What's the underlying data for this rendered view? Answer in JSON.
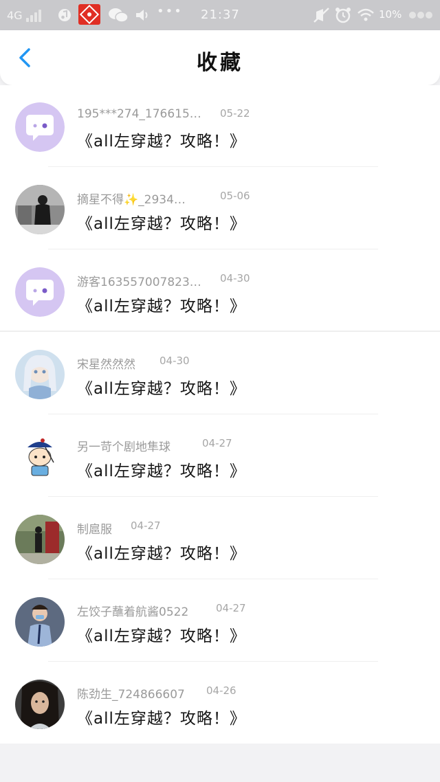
{
  "status_bar": {
    "network": "4G",
    "time": "21:37",
    "battery": "10%",
    "dots": "•••"
  },
  "header": {
    "title": "收藏",
    "back_icon": "chevron-left-icon"
  },
  "items": [
    {
      "name": "195***274_176615…",
      "date": "05-22",
      "title": "《all左穿越？攻略！》",
      "avatar": "chat-bubble-avatar",
      "avatar_color": "#d5c6f2"
    },
    {
      "name": "摘星不得✨_2934…",
      "date": "05-06",
      "title": "《all左穿越？攻略！》",
      "avatar": "photo-avatar-bw",
      "avatar_color": "#555555"
    },
    {
      "name": "游客163557007823…",
      "date": "04-30",
      "title": "《all左穿越？攻略！》",
      "avatar": "chat-bubble-avatar",
      "avatar_color": "#d5c6f2"
    },
    {
      "name": "宋星然然然",
      "date": "04-30",
      "title": "《all左穿越？攻略！》",
      "avatar": "anime-girl-avatar",
      "avatar_color": "#cfe0ee"
    },
    {
      "name": "另一苛个剧地隼球",
      "date": "04-27",
      "title": "《all左穿越？攻略！》",
      "avatar": "cartoon-official-avatar",
      "avatar_color": "#ffffff"
    },
    {
      "name": "制扈服",
      "date": "04-27",
      "title": "《all左穿越？攻略！》",
      "avatar": "street-photo-avatar",
      "avatar_color": "#6b7b5a"
    },
    {
      "name": "左饺子蘸着航酱0522",
      "date": "04-27",
      "title": "《all左穿越？攻略！》",
      "avatar": "boy-photo-avatar",
      "avatar_color": "#5d6a80"
    },
    {
      "name": "陈劲生_724866607",
      "date": "04-26",
      "title": "《all左穿越？攻略！》",
      "avatar": "portrait-photo-avatar",
      "avatar_color": "#3d3d3d"
    }
  ],
  "colors": {
    "accent": "#2196f3",
    "status_bar_bg": "#c9c9cc",
    "page_bg": "#f2f2f4"
  }
}
